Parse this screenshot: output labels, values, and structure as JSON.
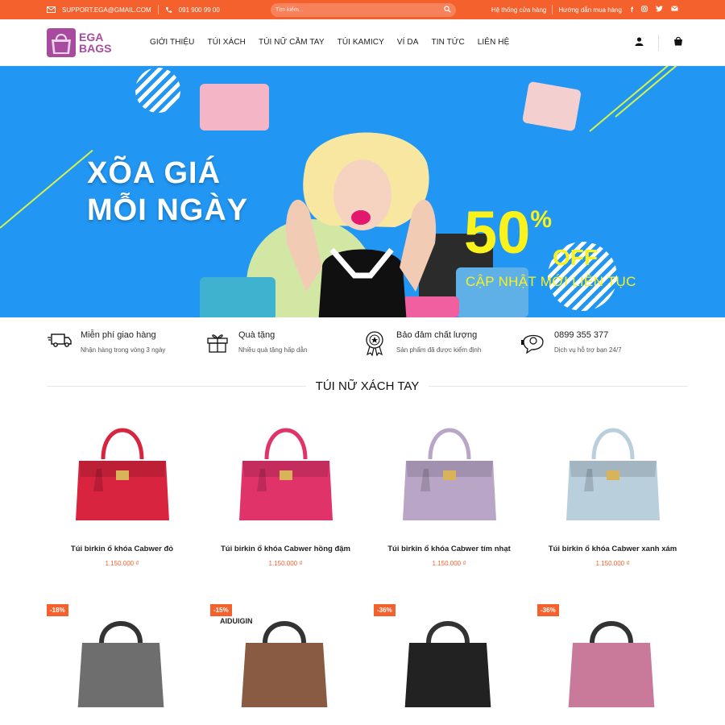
{
  "topbar": {
    "email": "SUPPORT.EGA@GMAIL.COM",
    "phone": "091 900 99 00",
    "search_placeholder": "Tìm kiếm...",
    "store_link": "Hệ thống cửa hàng",
    "guide_link": "Hướng dẫn mua hàng"
  },
  "header": {
    "logo_line1": "EGA",
    "logo_line2": "BAGS",
    "nav": [
      "GIỚI THIỆU",
      "TÚI XÁCH",
      "TÚI NỮ CẦM TAY",
      "TÚI KAMICY",
      "VÍ DA",
      "TIN TỨC",
      "LIÊN HỆ"
    ]
  },
  "banner": {
    "title_line1": "XÕA GIÁ",
    "title_line2": "MỖI NGÀY",
    "discount_number": "50",
    "discount_symbol": "%",
    "discount_off": "OFF",
    "subtitle": "CẬP NHẬT MỚI LIÊN TỤC"
  },
  "features": [
    {
      "title": "Miễn phí giao hàng",
      "desc": "Nhận hàng trong vòng 3 ngày",
      "icon": "truck-icon"
    },
    {
      "title": "Quà tặng",
      "desc": "Nhiều quà tặng hấp dẫn",
      "icon": "gift-icon"
    },
    {
      "title": "Bảo đảm chất lượng",
      "desc": "Sản phẩm đã được kiểm định",
      "icon": "award-icon"
    },
    {
      "title": "0899 355 377",
      "desc": "Dịch vụ hỗ trợ bạn 24/7",
      "icon": "support-icon"
    }
  ],
  "section": {
    "title": "TÚI NỮ XÁCH TAY"
  },
  "products": [
    {
      "name": "Túi birkin ổ khóa Cabwer đỏ",
      "price": "1.150.000 ₫",
      "color": "#d8243f"
    },
    {
      "name": "Túi birkin ổ khóa Cabwer hồng đậm",
      "price": "1.150.000 ₫",
      "color": "#e0336a"
    },
    {
      "name": "Túi birkin ổ khóa Cabwer tím nhạt",
      "price": "1.150.000 ₫",
      "color": "#b9a6c6"
    },
    {
      "name": "Túi birkin ổ khóa Cabwer xanh xám",
      "price": "1.150.000 ₫",
      "color": "#b9cfdc"
    }
  ],
  "products_row2": [
    {
      "badge": "-18%",
      "color": "#6e6e6e"
    },
    {
      "badge": "-15%",
      "color": "#8a5b43",
      "brand": "AIDUIGIN"
    },
    {
      "badge": "-36%",
      "color": "#222222"
    },
    {
      "badge": "-36%",
      "color": "#c97a9b"
    }
  ]
}
